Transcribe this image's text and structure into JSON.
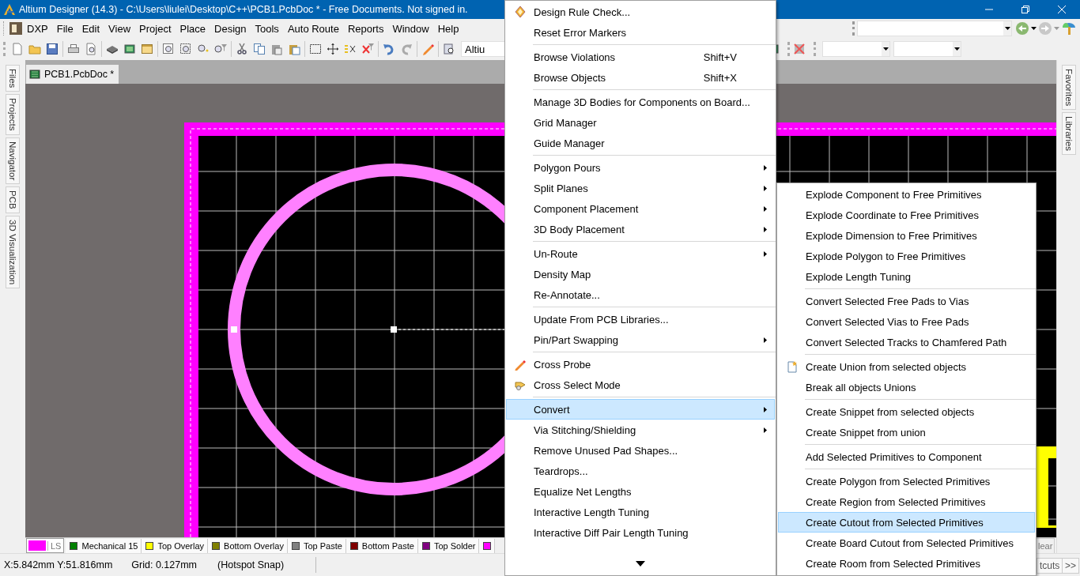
{
  "window": {
    "title": "Altium Designer (14.3) - C:\\Users\\liulei\\Desktop\\C++\\PCB1.PcbDoc * - Free Documents. Not signed in."
  },
  "menu_bar": {
    "items": [
      "DXP",
      "File",
      "Edit",
      "View",
      "Project",
      "Place",
      "Design",
      "Tools",
      "Auto Route",
      "Reports",
      "Window",
      "Help"
    ]
  },
  "toolbar": {
    "field_value": "Altiu"
  },
  "document_tabs": [
    {
      "label": "PCB1.PcbDoc *",
      "selected": true
    }
  ],
  "left_panel_tabs": [
    "Files",
    "Projects",
    "Navigator",
    "PCB",
    "3D Visualization"
  ],
  "right_panel_tabs": [
    "Favorites",
    "Libraries"
  ],
  "current_layer": {
    "label": "LS",
    "color": "#ff00ff"
  },
  "layers": [
    {
      "label": "Mechanical 15",
      "color": "#008000"
    },
    {
      "label": "Top Overlay",
      "color": "#ffff00"
    },
    {
      "label": "Bottom Overlay",
      "color": "#808000"
    },
    {
      "label": "Top Paste",
      "color": "#808080"
    },
    {
      "label": "Bottom Paste",
      "color": "#800000"
    },
    {
      "label": "Top Solder",
      "color": "#800080"
    },
    {
      "color": "#ff00ff"
    }
  ],
  "layer_bar_button": "lear",
  "status_bar": {
    "coordinates": "X:5.842mm Y:51.816mm",
    "grid": "Grid: 0.127mm",
    "snap": "(Hotspot Snap)",
    "buttons": [
      "tcuts",
      ">>"
    ]
  },
  "context_menu": {
    "more_below": true,
    "groups": [
      [
        {
          "label": "Design Rule Check...",
          "icon": true,
          "submenu": false,
          "selected": false
        },
        {
          "label": "Reset Error Markers",
          "icon": false,
          "submenu": false,
          "selected": false
        }
      ],
      [
        {
          "label": "Browse Violations",
          "shortcut": "Shift+V",
          "icon": false,
          "submenu": false,
          "selected": false
        },
        {
          "label": "Browse Objects",
          "shortcut": "Shift+X",
          "icon": false,
          "submenu": false,
          "selected": false
        }
      ],
      [
        {
          "label": "Manage 3D Bodies for Components on Board...",
          "icon": false,
          "submenu": false,
          "selected": false
        },
        {
          "label": "Grid Manager",
          "icon": false,
          "submenu": false,
          "selected": false
        },
        {
          "label": "Guide Manager",
          "icon": false,
          "submenu": false,
          "selected": false
        }
      ],
      [
        {
          "label": "Polygon Pours",
          "icon": false,
          "submenu": true,
          "selected": false
        },
        {
          "label": "Split Planes",
          "icon": false,
          "submenu": true,
          "selected": false
        },
        {
          "label": "Component Placement",
          "icon": false,
          "submenu": true,
          "selected": false
        },
        {
          "label": "3D Body Placement",
          "icon": false,
          "submenu": true,
          "selected": false
        }
      ],
      [
        {
          "label": "Un-Route",
          "icon": false,
          "submenu": true,
          "selected": false
        },
        {
          "label": "Density Map",
          "icon": false,
          "submenu": false,
          "selected": false
        },
        {
          "label": "Re-Annotate...",
          "icon": false,
          "submenu": false,
          "selected": false
        }
      ],
      [
        {
          "label": "Update From PCB Libraries...",
          "icon": false,
          "submenu": false,
          "selected": false
        },
        {
          "label": "Pin/Part Swapping",
          "icon": false,
          "submenu": true,
          "selected": false
        }
      ],
      [
        {
          "label": "Cross Probe",
          "icon": true,
          "submenu": false,
          "selected": false
        },
        {
          "label": "Cross Select Mode",
          "icon": true,
          "submenu": false,
          "selected": false
        }
      ],
      [
        {
          "label": "Convert",
          "icon": false,
          "submenu": true,
          "selected": true
        },
        {
          "label": "Via Stitching/Shielding",
          "icon": false,
          "submenu": true,
          "selected": false
        },
        {
          "label": "Remove Unused Pad Shapes...",
          "icon": false,
          "submenu": false,
          "selected": false
        },
        {
          "label": "Teardrops...",
          "icon": false,
          "submenu": false,
          "selected": false
        },
        {
          "label": "Equalize Net Lengths",
          "icon": false,
          "submenu": false,
          "selected": false
        },
        {
          "label": "Interactive Length Tuning",
          "icon": false,
          "submenu": false,
          "selected": false
        },
        {
          "label": "Interactive Diff Pair Length Tuning",
          "icon": false,
          "submenu": false,
          "selected": false
        }
      ]
    ]
  },
  "submenu": {
    "groups": [
      [
        {
          "label": "Explode Component to Free Primitives",
          "icon": false,
          "selected": false
        },
        {
          "label": "Explode Coordinate to Free Primitives",
          "icon": false,
          "selected": false
        },
        {
          "label": "Explode Dimension to Free Primitives",
          "icon": false,
          "selected": false
        },
        {
          "label": "Explode Polygon to Free Primitives",
          "icon": false,
          "selected": false
        },
        {
          "label": "Explode Length Tuning",
          "icon": false,
          "selected": false
        }
      ],
      [
        {
          "label": "Convert Selected Free Pads to Vias",
          "icon": false,
          "selected": false
        },
        {
          "label": "Convert Selected Vias to Free Pads",
          "icon": false,
          "selected": false
        },
        {
          "label": "Convert Selected Tracks to Chamfered Path",
          "icon": false,
          "selected": false
        }
      ],
      [
        {
          "label": "Create Union from selected objects",
          "icon": true,
          "selected": false
        },
        {
          "label": "Break all objects Unions",
          "icon": false,
          "selected": false
        }
      ],
      [
        {
          "label": "Create Snippet from selected objects",
          "icon": false,
          "selected": false
        },
        {
          "label": "Create Snippet from union",
          "icon": false,
          "selected": false
        }
      ],
      [
        {
          "label": "Add Selected Primitives to Component",
          "icon": false,
          "selected": false
        }
      ],
      [
        {
          "label": "Create Polygon from Selected Primitives",
          "icon": false,
          "selected": false
        },
        {
          "label": "Create Region from Selected Primitives",
          "icon": false,
          "selected": false
        },
        {
          "label": "Create Cutout from Selected Primitives",
          "icon": false,
          "selected": true
        },
        {
          "label": "Create Board Cutout from Selected Primitives",
          "icon": false,
          "selected": false
        },
        {
          "label": "Create Room from Selected Primitives",
          "icon": false,
          "selected": false
        }
      ]
    ]
  }
}
